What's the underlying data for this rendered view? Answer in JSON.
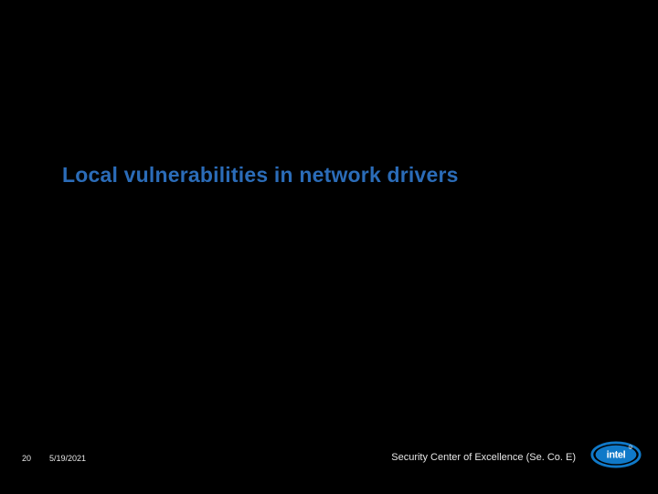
{
  "slide": {
    "title": "Local vulnerabilities in network drivers"
  },
  "footer": {
    "page_number": "20",
    "date": "5/19/2021",
    "organization": "Security Center of Excellence (Se. Co. E)",
    "logo_name": "intel"
  }
}
